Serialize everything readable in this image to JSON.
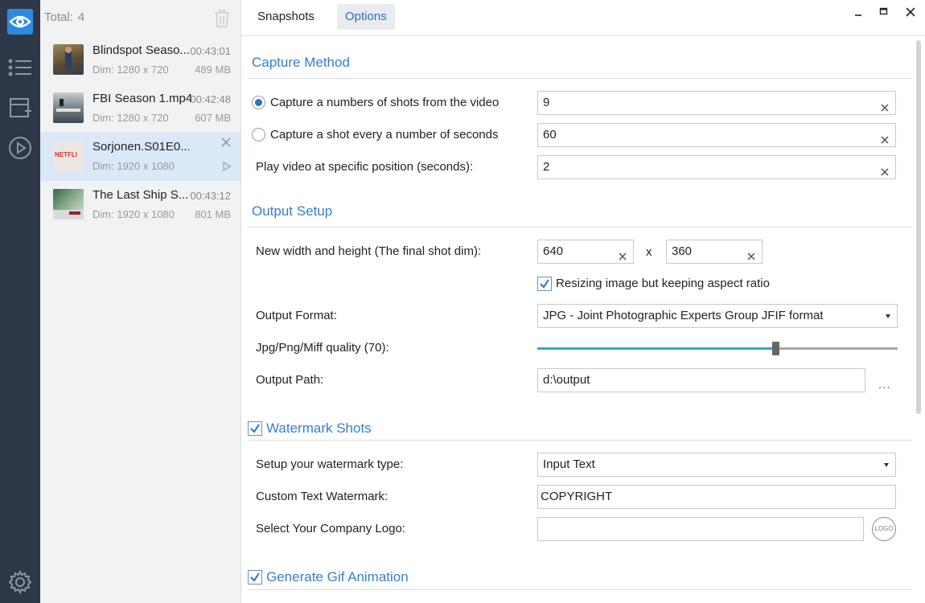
{
  "rail": {
    "icons": [
      "eye-logo-icon",
      "list-icon",
      "add-media-icon",
      "play-circle-icon",
      "settings-icon"
    ]
  },
  "list": {
    "total_label": "Total:",
    "total_count": "4",
    "items": [
      {
        "title": "Blindspot Seaso...",
        "duration": "00:43:01",
        "dim": "Dim: 1280 x 720",
        "size": "489 MB",
        "thumb_color": "#7a6a4a"
      },
      {
        "title": "FBI Season 1.mp4",
        "duration": "00:42:48",
        "dim": "Dim: 1280 x 720",
        "size": "607 MB",
        "thumb_color": "#6f7a80"
      },
      {
        "title": "Sorjonen.S01E0...",
        "duration": "",
        "dim": "Dim: 1920 x 1080",
        "size": "",
        "thumb_color": "#e8e4e0",
        "thumb_text": "NETFLI"
      },
      {
        "title": "The Last Ship S...",
        "duration": "00:43:12",
        "dim": "Dim: 1920 x 1080",
        "size": "801 MB",
        "thumb_color": "#3a6a4a"
      }
    ]
  },
  "tabs": {
    "snapshots": "Snapshots",
    "options": "Options"
  },
  "capture": {
    "title": "Capture Method",
    "shots_label": "Capture a numbers of shots from the video",
    "shots_value": "9",
    "seconds_label": "Capture a shot every a number of seconds",
    "seconds_value": "60",
    "position_label": "Play video at specific position (seconds):",
    "position_value": "2"
  },
  "output": {
    "title": "Output Setup",
    "dim_label": "New width and height (The final shot dim):",
    "width_value": "640",
    "x_label": "x",
    "height_value": "360",
    "aspect_label": "Resizing image but keeping aspect ratio",
    "format_label": "Output Format:",
    "format_value": "JPG  - Joint Photographic Experts Group JFIF format",
    "quality_label": "Jpg/Png/Miff quality (70):",
    "quality_fraction": 0.66,
    "path_label": "Output Path:",
    "path_value": "d:\\output",
    "browse_label": "..."
  },
  "watermark": {
    "title": "Watermark Shots",
    "type_label": "Setup your watermark type:",
    "type_value": "Input Text",
    "text_label": "Custom Text Watermark:",
    "text_value": "COPYRIGHT",
    "logo_label": "Select Your Company Logo:",
    "logo_value": "",
    "logo_button": "LOGO"
  },
  "gif": {
    "title": "Generate Gif Animation"
  },
  "colors": {
    "accent": "#3a7dc8",
    "rail": "#2e3747",
    "selected": "#dbe8f8",
    "slider": "#3aa3d6"
  }
}
